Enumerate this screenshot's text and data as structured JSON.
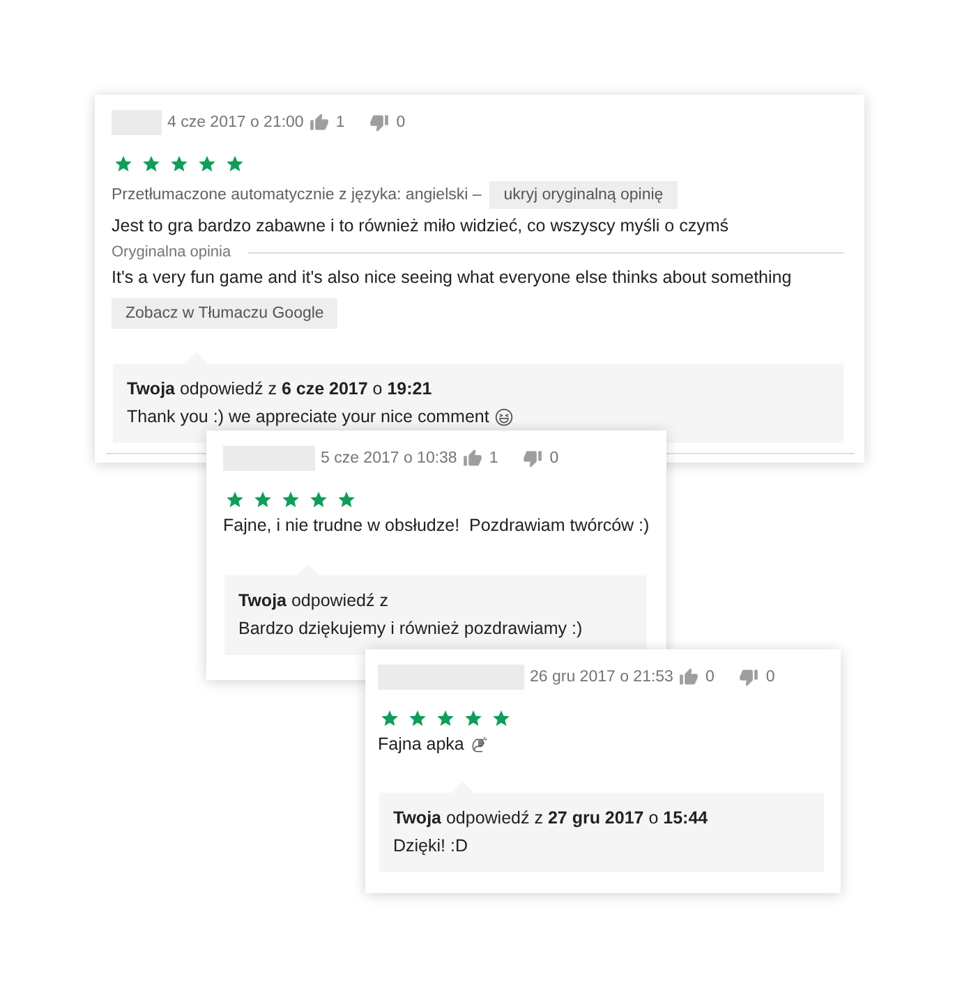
{
  "reviews": [
    {
      "kind": "translated",
      "date": "4 cze 2017 o 21:00",
      "likes": "1",
      "dislikes": "0",
      "stars": 5,
      "translation_note": "Przetłumaczone automatycznie z języka: angielski –",
      "hide_original_button": "ukryj oryginalną opinię",
      "text": "Jest to gra bardzo zabawne i to również miło widzieć, co wszyscy myśli o czymś",
      "original_label": "Oryginalna opinia",
      "original_text": "It's a very fun game and it's also nice seeing what everyone else thinks about something",
      "translate_button": "Zobacz w Tłumaczu Google",
      "reply": {
        "header": "**Twoja** odpowiedź z **6 cze 2017** o **19:21**",
        "text": "Thank you :) we appreciate your nice comment",
        "emoji": {
          "kind": "laughing"
        }
      }
    },
    {
      "kind": "plain",
      "date": "5 cze 2017 o 10:38",
      "likes": "1",
      "dislikes": "0",
      "stars": 5,
      "text": "Fajne, i nie trudne w obsłudze!  Pozdrawiam twórców :)",
      "reply": {
        "header": "**Twoja** odpowiedź z",
        "text": "Bardzo dziękujemy i również pozdrawiamy :)"
      }
    },
    {
      "kind": "plain",
      "date": "26 gru 2017 o 21:53",
      "likes": "0",
      "dislikes": "0",
      "stars": 5,
      "text": "Fajna apka",
      "emoji": {
        "kind": "clapping"
      },
      "reply": {
        "header": "**Twoja** odpowiedź z **27 gru 2017** o **15:44**",
        "text": "Dzięki! :D"
      }
    }
  ]
}
